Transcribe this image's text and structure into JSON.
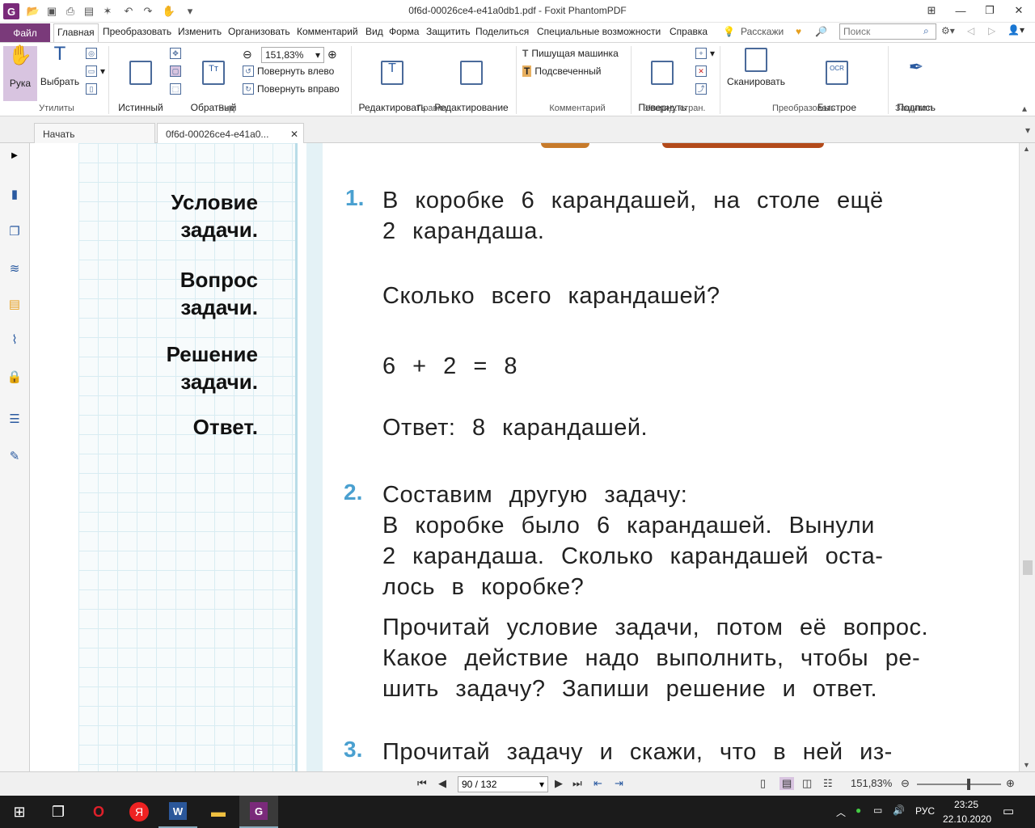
{
  "window": {
    "title": "0f6d-00026ce4-e41a0db1.pdf - Foxit PhantomPDF"
  },
  "menu": {
    "file": "Файл",
    "tabs": [
      "Главная",
      "Преобразовать",
      "Изменить",
      "Организовать",
      "Комментарий",
      "Вид",
      "Форма",
      "Защитить",
      "Поделиться",
      "Специальные возможности",
      "Справка"
    ],
    "tell_me": "Расскажи",
    "search_placeholder": "Поиск"
  },
  "ribbon": {
    "hand": "Рука",
    "select": "Выбрать",
    "utilities": "Утилиты",
    "actual_size": "Истинный\nразмер",
    "reverse_order": "Обратный\nпорядок",
    "zoom": "151,83%",
    "rotate_left": "Повернуть влево",
    "rotate_right": "Повернуть вправо",
    "view_group": "Вид",
    "edit_text": "Редактировать\nтекст",
    "edit_objects": "Редактирование\nобъектов",
    "edit_group": "Правка",
    "typewriter": "Пишущая машинка",
    "highlight": "Подсвеченный",
    "comment_group": "Комментарий",
    "rotate_pages": "Повернуть\nстраницы",
    "pages_group": "Упоряд. стран.",
    "scan": "Сканировать",
    "ocr": "Быстрое\nOCR-распознавание",
    "convert_group": "Преобразовать",
    "sign": "Подпись\nPDF",
    "protect_group": "Защитить"
  },
  "tabs": {
    "start": "Начать",
    "doc": "0f6d-00026ce4-e41a0..."
  },
  "document": {
    "labels": [
      "Условие\nзадачи.",
      "Вопрос\nзадачи.",
      "Решение\nзадачи.",
      "Ответ."
    ],
    "task1_num": "1.",
    "task1_line1": "В коробке 6 карандашей, на столе ещё",
    "task1_line2": "2 карандаша.",
    "task1_question": "Сколько всего карандашей?",
    "task1_solution": "6 + 2 = 8",
    "task1_answer": "Ответ: 8 карандашей.",
    "task2_num": "2.",
    "task2_l1": "Составим другую задачу:",
    "task2_l2": "В коробке было 6 карандашей. Вынули",
    "task2_l3": "2 карандаша. Сколько карандашей оста-",
    "task2_l4": "лось в коробке?",
    "task2_l5": "Прочитай условие задачи, потом её вопрос.",
    "task2_l6": "Какое действие надо выполнить, чтобы ре-",
    "task2_l7": "шить задачу? Запиши решение и ответ.",
    "task3_num": "3.",
    "task3_l1": "Прочитай задачу и скажи, что в ней из-"
  },
  "status": {
    "page": "90 / 132",
    "zoom": "151,83%"
  },
  "taskbar": {
    "lang": "РУС",
    "time": "23:25",
    "date": "22.10.2020"
  }
}
